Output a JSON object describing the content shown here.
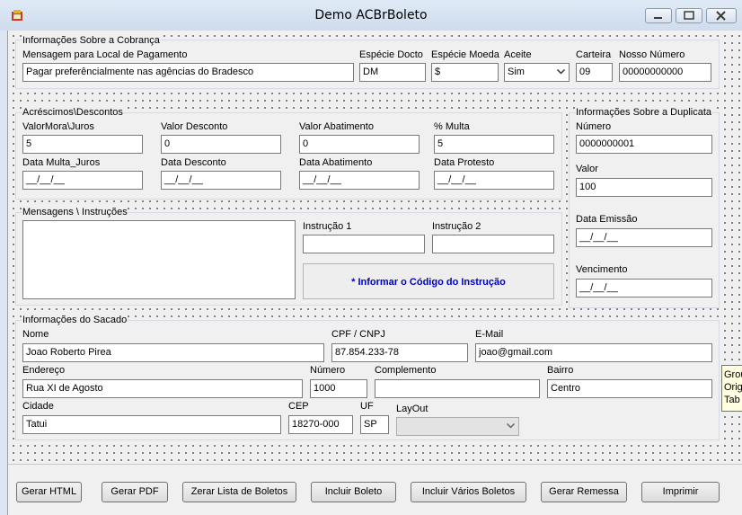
{
  "window": {
    "title": "Demo ACBrBoleto"
  },
  "cobranca": {
    "group_label": "Informações Sobre a Cobrança",
    "local_pagamento_label": "Mensagem para Local de Pagamento",
    "local_pagamento": "Pagar preferêncialmente nas agências do Bradesco",
    "especie_docto_label": "Espécie Docto",
    "especie_docto": "DM",
    "especie_moeda_label": "Espécie Moeda",
    "especie_moeda": "$",
    "aceite_label": "Aceite",
    "aceite": "Sim",
    "carteira_label": "Carteira",
    "carteira": "09",
    "nosso_numero_label": "Nosso Número",
    "nosso_numero": "00000000000"
  },
  "acrescimos": {
    "group_label": "Acréscimos\\Descontos",
    "valor_mora_label": "ValorMora\\Juros",
    "valor_mora": "5",
    "valor_desconto_label": "Valor Desconto",
    "valor_desconto": "0",
    "valor_abatimento_label": "Valor Abatimento",
    "valor_abatimento": "0",
    "multa_label": "% Multa",
    "multa": "5",
    "data_multa_label": "Data Multa_Juros",
    "data_multa": "__/__/__",
    "data_desconto_label": "Data Desconto",
    "data_desconto": "__/__/__",
    "data_abatimento_label": "Data Abatimento",
    "data_abatimento": "__/__/__",
    "data_protesto_label": "Data Protesto",
    "data_protesto": "__/__/__"
  },
  "mensagens": {
    "group_label": "Mensagens \\ Instruções",
    "instrucao1_label": "Instrução 1",
    "instrucao1": "",
    "instrucao2_label": "Instrução 2",
    "instrucao2": "",
    "info_button": "* Informar o Código do Instrução"
  },
  "duplicata": {
    "group_label": "Informações Sobre a Duplicata",
    "numero_label": "Número",
    "numero": "0000000001",
    "valor_label": "Valor",
    "valor": "100",
    "data_emissao_label": "Data Emissão",
    "data_emissao": "__/__/__",
    "vencimento_label": "Vencimento",
    "vencimento": "__/__/__"
  },
  "sacado": {
    "group_label": "Informações do Sacado",
    "nome_label": "Nome",
    "nome": "Joao Roberto Pirea",
    "cpf_label": "CPF / CNPJ",
    "cpf": "87.854.233-78",
    "email_label": "E-Mail",
    "email": "joao@gmail.com",
    "endereco_label": "Endereço",
    "endereco": "Rua XI de Agosto",
    "numero_label": "Número",
    "numero": "1000",
    "complemento_label": "Complemento",
    "complemento": "",
    "bairro_label": "Bairro",
    "bairro": "Centro",
    "cidade_label": "Cidade",
    "cidade": "Tatui",
    "cep_label": "CEP",
    "cep": "18270-000",
    "uf_label": "UF",
    "uf": "SP",
    "layout_label": "LayOut",
    "layout": ""
  },
  "buttons": {
    "gerar_html": "Gerar HTML",
    "gerar_pdf": "Gerar PDF",
    "zerar_lista": "Zerar Lista de Boletos",
    "incluir_boleto": "Incluir Boleto",
    "incluir_varios": "Incluir Vários Boletos",
    "gerar_remessa": "Gerar Remessa",
    "imprimir": "Imprimir"
  },
  "tooltip": {
    "lines": [
      "Grou",
      "Orig",
      "Tab"
    ]
  },
  "icons": {
    "app": "app-icon",
    "minimize": "minimize-icon",
    "maximize": "maximize-icon",
    "close": "close-icon",
    "dropdown": "chevron-down-icon"
  }
}
